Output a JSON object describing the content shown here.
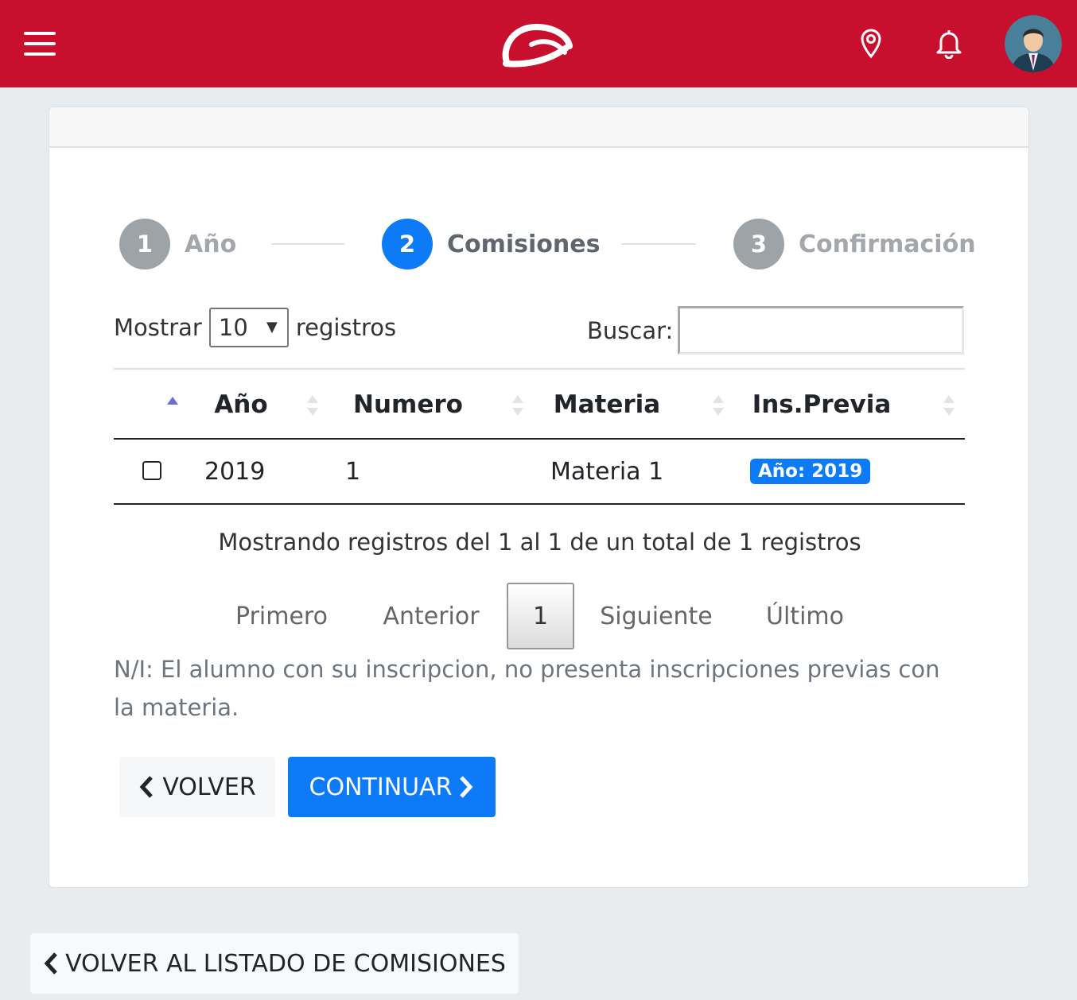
{
  "header": {
    "menu_icon": "hamburger-icon",
    "logo_icon": "brand-logo",
    "location_icon": "map-pin-icon",
    "notification_icon": "bell-icon",
    "avatar_icon": "user-avatar"
  },
  "colors": {
    "brand": "#c8102e",
    "accent": "#0d7bf7",
    "muted": "#9ea3a8"
  },
  "stepper": [
    {
      "number": "1",
      "label": "Año",
      "state": "inactive"
    },
    {
      "number": "2",
      "label": "Comisiones",
      "state": "active"
    },
    {
      "number": "3",
      "label": "Confirmación",
      "state": "inactive"
    }
  ],
  "controls": {
    "show_label": "Mostrar",
    "page_size": "10",
    "records_label": "registros",
    "search_label": "Buscar:",
    "search_value": ""
  },
  "table": {
    "columns": [
      "Año",
      "Numero",
      "Materia",
      "Ins.Previa"
    ],
    "rows": [
      {
        "anio": "2019",
        "numero": "1",
        "materia": "Materia 1",
        "ins_previa": "Año: 2019"
      }
    ]
  },
  "info_text": "Mostrando registros del 1 al 1 de un total de 1 registros",
  "pagination": {
    "first": "Primero",
    "previous": "Anterior",
    "current": "1",
    "next": "Siguiente",
    "last": "Último"
  },
  "note": "N/I: El alumno con su inscripcion, no presenta inscripciones previas con la materia.",
  "buttons": {
    "back": "VOLVER",
    "continue": "CONTINUAR",
    "back_to_list": "VOLVER AL LISTADO DE COMISIONES"
  }
}
